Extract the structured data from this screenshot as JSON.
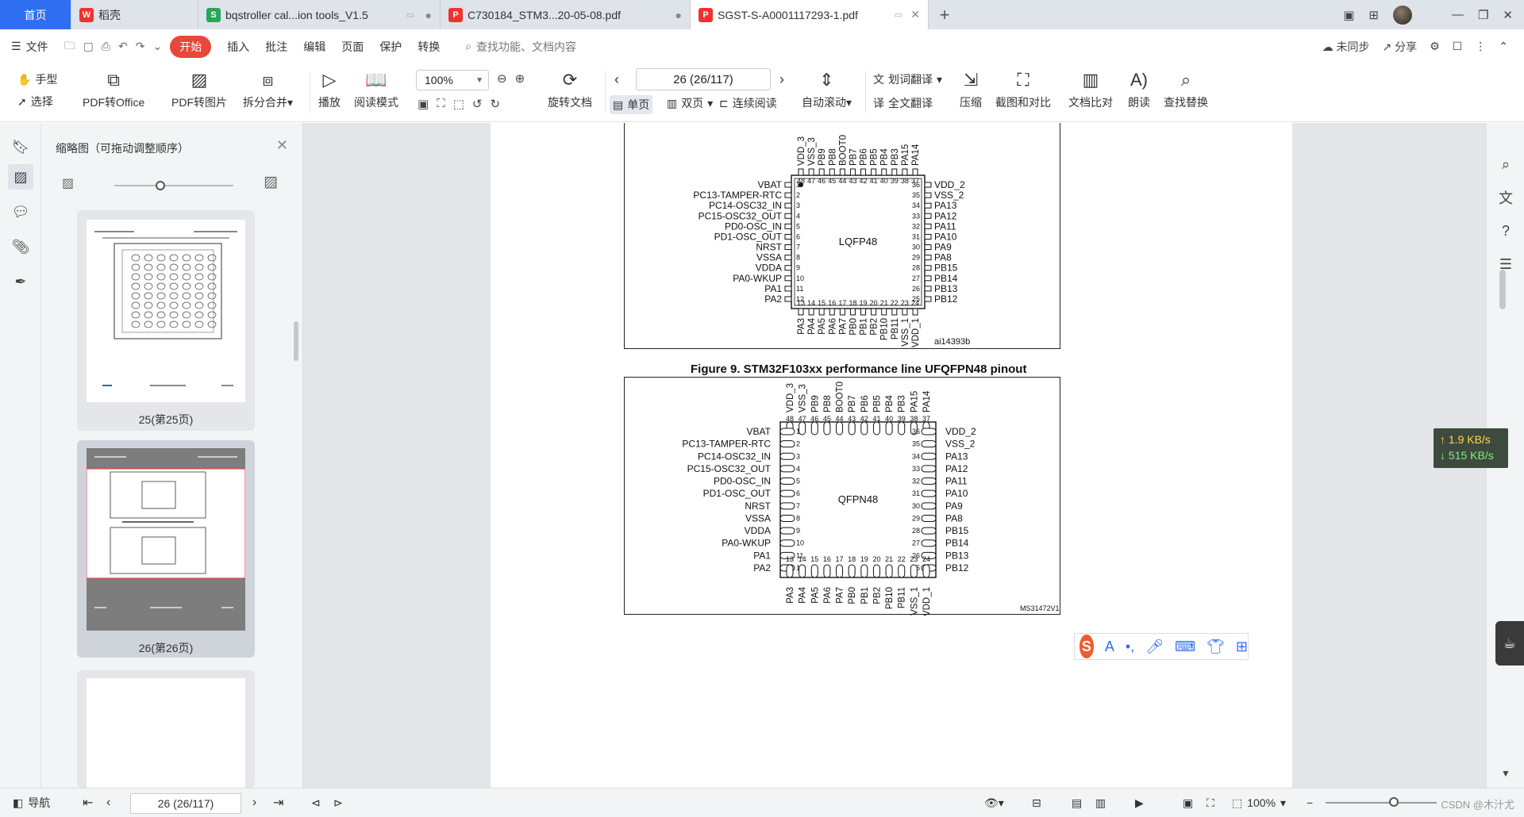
{
  "tabs": {
    "home": "首页",
    "t1": "稻壳",
    "t2": "bqstroller cal...ion tools_V1.5",
    "t3": "C730184_STM3...20-05-08.pdf",
    "t4": "SGST-S-A0001117293-1.pdf"
  },
  "menu": {
    "file": "文件",
    "items": [
      "开始",
      "插入",
      "批注",
      "编辑",
      "页面",
      "保护",
      "转换"
    ],
    "search": "查找功能、文档内容",
    "sync": "未同步",
    "share": "分享"
  },
  "toolbar": {
    "hand": "手型",
    "select": "选择",
    "pdf_office": "PDF转Office",
    "pdf_image": "PDF转图片",
    "split_merge": "拆分合并",
    "play": "播放",
    "read_mode": "阅读模式",
    "zoom": "100%",
    "page_input": "26 (26/117)",
    "rotate": "旋转文档",
    "single": "单页",
    "double": "双页",
    "continuous": "连续阅读",
    "autoscroll": "自动滚动",
    "word_translate": "划词翻译",
    "full_translate": "全文翻译",
    "compress": "压缩",
    "screenshot_compare": "截图和对比",
    "doc_compare": "文档比对",
    "read_aloud": "朗读",
    "find_replace": "查找替换"
  },
  "thumbnails": {
    "title": "缩略图（可拖动调整顺序）",
    "p25": "25(第25页)",
    "p26": "26(第26页)"
  },
  "lqfp": {
    "label": "LQFP48",
    "id": "ai14393b",
    "top_pins": [
      "VDD_3",
      "VSS_3",
      "PB9",
      "PB8",
      "BOOT0",
      "PB7",
      "PB6",
      "PB5",
      "PB4",
      "PB3",
      "PA15",
      "PA14"
    ],
    "top_nums": [
      "48",
      "47",
      "46",
      "45",
      "44",
      "43",
      "42",
      "41",
      "40",
      "39",
      "38",
      "37"
    ],
    "left_pins": [
      "VBAT",
      "PC13-TAMPER-RTC",
      "PC14-OSC32_IN",
      "PC15-OSC32_OUT",
      "PD0-OSC_IN",
      "PD1-OSC_OUT",
      "NRST",
      "VSSA",
      "VDDA",
      "PA0-WKUP",
      "PA1",
      "PA2"
    ],
    "left_nums": [
      "1",
      "2",
      "3",
      "4",
      "5",
      "6",
      "7",
      "8",
      "9",
      "10",
      "11",
      "12"
    ],
    "right_pins": [
      "VDD_2",
      "VSS_2",
      "PA13",
      "PA12",
      "PA11",
      "PA10",
      "PA9",
      "PA8",
      "PB15",
      "PB14",
      "PB13",
      "PB12"
    ],
    "right_nums": [
      "36",
      "35",
      "34",
      "33",
      "32",
      "31",
      "30",
      "29",
      "28",
      "27",
      "26",
      "25"
    ],
    "bottom_pins": [
      "PA3",
      "PA4",
      "PA5",
      "PA6",
      "PA7",
      "PB0",
      "PB1",
      "PB2",
      "PB10",
      "PB11",
      "VSS_1",
      "VDD_1"
    ],
    "bottom_nums": [
      "13",
      "14",
      "15",
      "16",
      "17",
      "18",
      "19",
      "20",
      "21",
      "22",
      "23",
      "24"
    ]
  },
  "qfpn": {
    "caption": "Figure 9. STM32F103xx performance line UFQFPN48 pinout",
    "label": "QFPN48",
    "id": "MS31472V1"
  },
  "netspeed": {
    "up": "↑ 1.9 KB/s",
    "down": "↓ 515 KB/s"
  },
  "ime": {
    "logo": "S",
    "a": "A"
  },
  "status": {
    "nav": "导航",
    "page": "26 (26/117)",
    "zoom": "100%",
    "watermark": "CSDN @木汁尤"
  }
}
